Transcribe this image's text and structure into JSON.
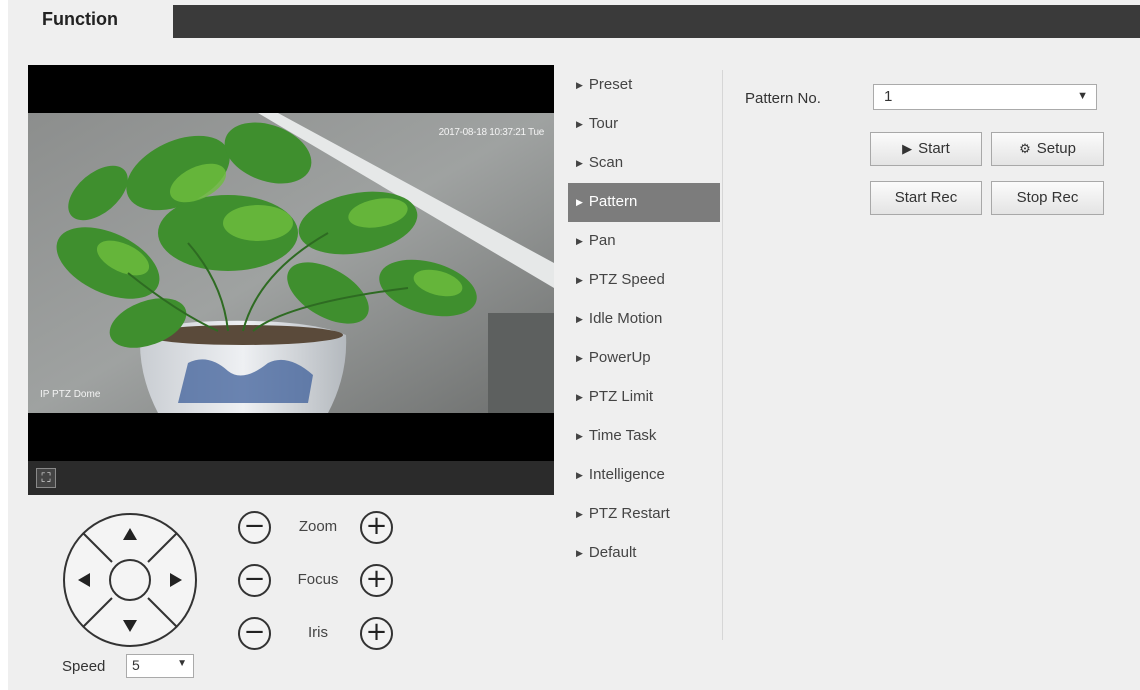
{
  "tab": {
    "label": "Function"
  },
  "video": {
    "osd_time": "2017-08-18 10:37:21 Tue",
    "osd_name": "IP PTZ Dome",
    "fullscreen_icon": "fullscreen-icon"
  },
  "ptz": {
    "speed_label": "Speed",
    "speed_value": "5",
    "zoom_label": "Zoom",
    "focus_label": "Focus",
    "iris_label": "Iris",
    "minus": "−",
    "plus": "+"
  },
  "menu": {
    "items": [
      {
        "label": "Preset"
      },
      {
        "label": "Tour"
      },
      {
        "label": "Scan"
      },
      {
        "label": "Pattern"
      },
      {
        "label": "Pan"
      },
      {
        "label": "PTZ Speed"
      },
      {
        "label": "Idle Motion"
      },
      {
        "label": "PowerUp"
      },
      {
        "label": "PTZ Limit"
      },
      {
        "label": "Time Task"
      },
      {
        "label": "Intelligence"
      },
      {
        "label": "PTZ Restart"
      },
      {
        "label": "Default"
      }
    ],
    "active": "Pattern"
  },
  "pattern": {
    "label": "Pattern No.",
    "value": "1",
    "start_label": "Start",
    "setup_label": "Setup",
    "start_rec_label": "Start Rec",
    "stop_rec_label": "Stop Rec"
  },
  "colors": {
    "active_menu_bg": "#7c7c7c",
    "tab_bar": "#3a3a3a",
    "panel_bg": "#efefef"
  }
}
